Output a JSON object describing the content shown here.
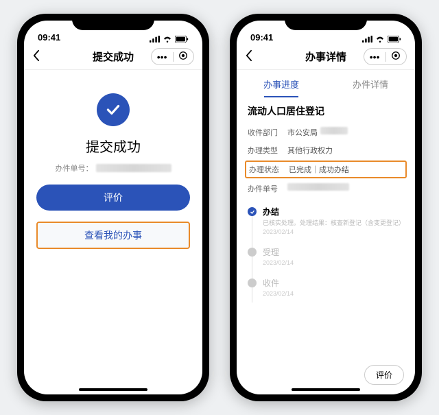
{
  "status_time": "09:41",
  "phone1": {
    "nav_title": "提交成功",
    "success_title": "提交成功",
    "case_label": "办件单号：",
    "btn_primary": "评价",
    "btn_outline": "查看我的办事"
  },
  "phone2": {
    "nav_title": "办事详情",
    "tabs": {
      "progress": "办事进度",
      "detail": "办件详情"
    },
    "service_title": "流动人口居住登记",
    "rows": {
      "dept_k": "收件部门",
      "dept_v": "市公安局",
      "type_k": "办理类型",
      "type_v": "其他行政权力",
      "status_k": "办理状态",
      "status_v": "已完成｜成功办结",
      "case_k": "办件单号"
    },
    "timeline": [
      {
        "title": "办结",
        "desc": "已核实处理。处理结果：核查新登记（含变更登记）",
        "date": "2023/02/14",
        "active": true
      },
      {
        "title": "受理",
        "desc": "",
        "date": "2023/02/14",
        "active": false
      },
      {
        "title": "收件",
        "desc": "",
        "date": "2023/02/14",
        "active": false
      }
    ],
    "bottom_eval": "评价"
  }
}
